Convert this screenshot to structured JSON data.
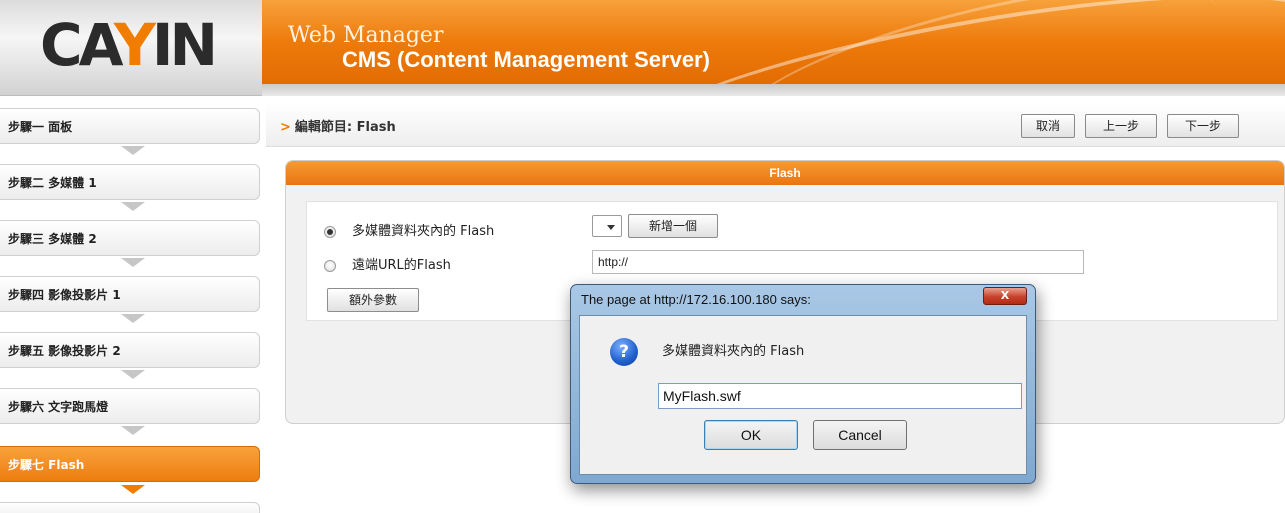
{
  "brand": {
    "logo_text": "CAYIN",
    "title": "Web Manager",
    "subtitle": "CMS (Content Management Server)"
  },
  "sidebar": {
    "items": [
      {
        "label": "步驟一 面板",
        "active": false
      },
      {
        "label": "步驟二 多媒體 1",
        "active": false
      },
      {
        "label": "步驟三 多媒體 2",
        "active": false
      },
      {
        "label": "步驟四 影像投影片 1",
        "active": false
      },
      {
        "label": "步驟五 影像投影片 2",
        "active": false
      },
      {
        "label": "步驟六 文字跑馬燈",
        "active": false
      },
      {
        "label": "步驟七 Flash",
        "active": true
      }
    ]
  },
  "toolbar": {
    "breadcrumb_prefix": ">",
    "breadcrumb": "編輯節目: Flash",
    "cancel_label": "取消",
    "prev_label": "上一步",
    "next_label": "下一步"
  },
  "panel": {
    "title": "Flash",
    "option_local_label": "多媒體資料夾內的 Flash",
    "option_remote_label": "遠端URL的Flash",
    "add_new_label": "新增一個",
    "url_value": "http://",
    "extra_params_label": "額外參數",
    "selected_option": "local"
  },
  "dialog": {
    "title": "The page at http://172.16.100.180 says:",
    "close_glyph": "X",
    "icon_glyph": "?",
    "message": "多媒體資料夾內的 Flash",
    "input_value": "MyFlash.swf",
    "ok_label": "OK",
    "cancel_label": "Cancel"
  }
}
